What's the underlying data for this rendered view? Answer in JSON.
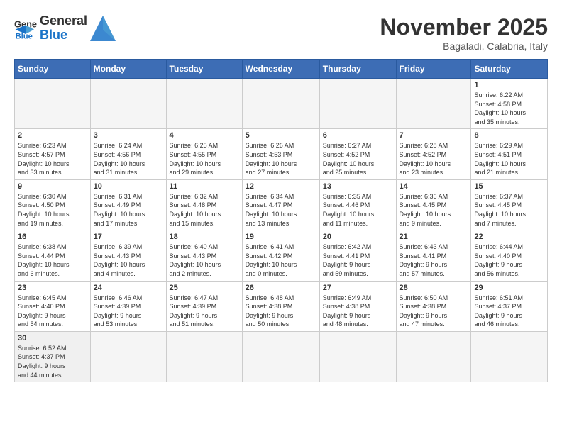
{
  "logo": {
    "text_general": "General",
    "text_blue": "Blue"
  },
  "header": {
    "month": "November 2025",
    "location": "Bagaladi, Calabria, Italy"
  },
  "weekdays": [
    "Sunday",
    "Monday",
    "Tuesday",
    "Wednesday",
    "Thursday",
    "Friday",
    "Saturday"
  ],
  "weeks": [
    [
      {
        "day": "",
        "info": "",
        "empty": true
      },
      {
        "day": "",
        "info": "",
        "empty": true
      },
      {
        "day": "",
        "info": "",
        "empty": true
      },
      {
        "day": "",
        "info": "",
        "empty": true
      },
      {
        "day": "",
        "info": "",
        "empty": true
      },
      {
        "day": "",
        "info": "",
        "empty": true
      },
      {
        "day": "1",
        "info": "Sunrise: 6:22 AM\nSunset: 4:58 PM\nDaylight: 10 hours\nand 35 minutes."
      }
    ],
    [
      {
        "day": "2",
        "info": "Sunrise: 6:23 AM\nSunset: 4:57 PM\nDaylight: 10 hours\nand 33 minutes."
      },
      {
        "day": "3",
        "info": "Sunrise: 6:24 AM\nSunset: 4:56 PM\nDaylight: 10 hours\nand 31 minutes."
      },
      {
        "day": "4",
        "info": "Sunrise: 6:25 AM\nSunset: 4:55 PM\nDaylight: 10 hours\nand 29 minutes."
      },
      {
        "day": "5",
        "info": "Sunrise: 6:26 AM\nSunset: 4:53 PM\nDaylight: 10 hours\nand 27 minutes."
      },
      {
        "day": "6",
        "info": "Sunrise: 6:27 AM\nSunset: 4:52 PM\nDaylight: 10 hours\nand 25 minutes."
      },
      {
        "day": "7",
        "info": "Sunrise: 6:28 AM\nSunset: 4:52 PM\nDaylight: 10 hours\nand 23 minutes."
      },
      {
        "day": "8",
        "info": "Sunrise: 6:29 AM\nSunset: 4:51 PM\nDaylight: 10 hours\nand 21 minutes."
      }
    ],
    [
      {
        "day": "9",
        "info": "Sunrise: 6:30 AM\nSunset: 4:50 PM\nDaylight: 10 hours\nand 19 minutes."
      },
      {
        "day": "10",
        "info": "Sunrise: 6:31 AM\nSunset: 4:49 PM\nDaylight: 10 hours\nand 17 minutes."
      },
      {
        "day": "11",
        "info": "Sunrise: 6:32 AM\nSunset: 4:48 PM\nDaylight: 10 hours\nand 15 minutes."
      },
      {
        "day": "12",
        "info": "Sunrise: 6:34 AM\nSunset: 4:47 PM\nDaylight: 10 hours\nand 13 minutes."
      },
      {
        "day": "13",
        "info": "Sunrise: 6:35 AM\nSunset: 4:46 PM\nDaylight: 10 hours\nand 11 minutes."
      },
      {
        "day": "14",
        "info": "Sunrise: 6:36 AM\nSunset: 4:45 PM\nDaylight: 10 hours\nand 9 minutes."
      },
      {
        "day": "15",
        "info": "Sunrise: 6:37 AM\nSunset: 4:45 PM\nDaylight: 10 hours\nand 7 minutes."
      }
    ],
    [
      {
        "day": "16",
        "info": "Sunrise: 6:38 AM\nSunset: 4:44 PM\nDaylight: 10 hours\nand 6 minutes."
      },
      {
        "day": "17",
        "info": "Sunrise: 6:39 AM\nSunset: 4:43 PM\nDaylight: 10 hours\nand 4 minutes."
      },
      {
        "day": "18",
        "info": "Sunrise: 6:40 AM\nSunset: 4:43 PM\nDaylight: 10 hours\nand 2 minutes."
      },
      {
        "day": "19",
        "info": "Sunrise: 6:41 AM\nSunset: 4:42 PM\nDaylight: 10 hours\nand 0 minutes."
      },
      {
        "day": "20",
        "info": "Sunrise: 6:42 AM\nSunset: 4:41 PM\nDaylight: 9 hours\nand 59 minutes."
      },
      {
        "day": "21",
        "info": "Sunrise: 6:43 AM\nSunset: 4:41 PM\nDaylight: 9 hours\nand 57 minutes."
      },
      {
        "day": "22",
        "info": "Sunrise: 6:44 AM\nSunset: 4:40 PM\nDaylight: 9 hours\nand 56 minutes."
      }
    ],
    [
      {
        "day": "23",
        "info": "Sunrise: 6:45 AM\nSunset: 4:40 PM\nDaylight: 9 hours\nand 54 minutes."
      },
      {
        "day": "24",
        "info": "Sunrise: 6:46 AM\nSunset: 4:39 PM\nDaylight: 9 hours\nand 53 minutes."
      },
      {
        "day": "25",
        "info": "Sunrise: 6:47 AM\nSunset: 4:39 PM\nDaylight: 9 hours\nand 51 minutes."
      },
      {
        "day": "26",
        "info": "Sunrise: 6:48 AM\nSunset: 4:38 PM\nDaylight: 9 hours\nand 50 minutes."
      },
      {
        "day": "27",
        "info": "Sunrise: 6:49 AM\nSunset: 4:38 PM\nDaylight: 9 hours\nand 48 minutes."
      },
      {
        "day": "28",
        "info": "Sunrise: 6:50 AM\nSunset: 4:38 PM\nDaylight: 9 hours\nand 47 minutes."
      },
      {
        "day": "29",
        "info": "Sunrise: 6:51 AM\nSunset: 4:37 PM\nDaylight: 9 hours\nand 46 minutes."
      }
    ],
    [
      {
        "day": "30",
        "info": "Sunrise: 6:52 AM\nSunset: 4:37 PM\nDaylight: 9 hours\nand 44 minutes.",
        "last": true
      },
      {
        "day": "",
        "info": "",
        "empty": true,
        "last": true
      },
      {
        "day": "",
        "info": "",
        "empty": true,
        "last": true
      },
      {
        "day": "",
        "info": "",
        "empty": true,
        "last": true
      },
      {
        "day": "",
        "info": "",
        "empty": true,
        "last": true
      },
      {
        "day": "",
        "info": "",
        "empty": true,
        "last": true
      },
      {
        "day": "",
        "info": "",
        "empty": true,
        "last": true
      }
    ]
  ]
}
